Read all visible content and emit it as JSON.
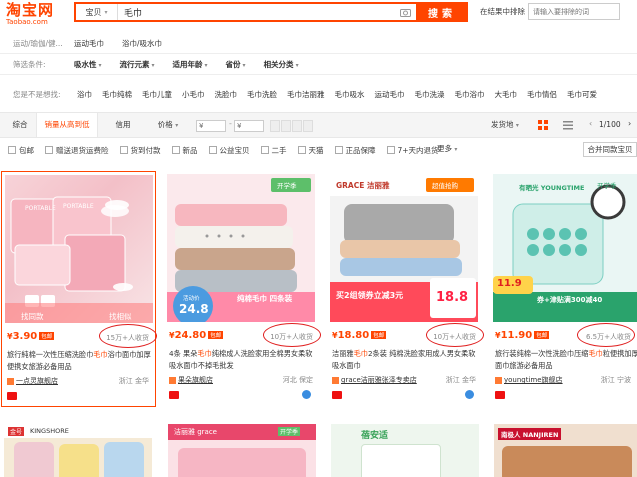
{
  "header": {
    "logo_main": "淘宝网",
    "logo_sub": "Taobao.com",
    "search_type": "宝贝",
    "search_value": "毛巾",
    "search_button": "搜索",
    "in_results_label": "在结果中排除",
    "in_results_placeholder": "请输入要排除的词"
  },
  "category_row": {
    "label": "运动/瑜伽/健...",
    "items": [
      "运动毛巾",
      "浴巾/吸水巾"
    ]
  },
  "filter_row": {
    "label": "筛选条件:",
    "items": [
      "吸水性",
      "流行元素",
      "适用年龄",
      "省份",
      "相关分类"
    ]
  },
  "related_row": {
    "label": "您是不是想找:",
    "items": [
      "浴巾",
      "毛巾纯棉",
      "毛巾儿童",
      "小毛巾",
      "洗脸巾",
      "毛巾洗脸",
      "毛巾洁丽雅",
      "毛巾吸水",
      "运动毛巾",
      "毛巾洗澡",
      "毛巾浴巾",
      "大毛巾",
      "毛巾情侣",
      "毛巾可爱"
    ]
  },
  "sort_bar": {
    "tabs": [
      "综合",
      "销量从高到低",
      "信用",
      "价格"
    ],
    "price_from": "¥",
    "price_to": "¥",
    "ship_from": "发货地",
    "page_indicator": "1/100"
  },
  "checkboxes": [
    "包邮",
    "赠送退货运费险",
    "货到付款",
    "新品",
    "公益宝贝",
    "二手",
    "天猫",
    "正品保障",
    "7+天内退货"
  ],
  "more_label": "更多",
  "merge_label": "合并同款宝贝",
  "products": [
    {
      "price": "3.90",
      "free_ship": "包邮",
      "sales": "15万+人收货",
      "title_pre": "旅行純棉一次性压缩洗脸巾",
      "title_hl": "毛巾",
      "title_post": "浴巾面巾加厚便携女旅游必备用品",
      "shop": "一点灵旗舰店",
      "location": "浙江 金华",
      "img_text_1": "PORTABLE",
      "img_btn_1": "找同款",
      "img_btn_2": "找相似"
    },
    {
      "price": "24.80",
      "free_ship": "包邮",
      "sales": "10万+人收货",
      "title_pre": "4条 果朵",
      "title_hl": "毛巾",
      "title_post": "纯棉成人洗脸家用全棉男女柔软吸水面巾不掉毛批发",
      "shop": "果朵旗舰店",
      "location": "河北 保定",
      "img_badge": "开学季",
      "img_promo": "纯棉毛巾 四条装",
      "img_price": "24.8",
      "img_note": "活动价"
    },
    {
      "price": "18.80",
      "free_ship": "包邮",
      "sales": "10万+人收货",
      "title_pre": "洁丽雅",
      "title_hl": "毛巾",
      "title_post": "2条装 纯棉洗脸家用成人男女柔软吸水面巾",
      "shop": "grace洁丽雅张泽专卖店",
      "location": "浙江 金华",
      "img_brand": "GRACE 洁丽雅",
      "img_badge": "超值抢购",
      "img_promo": "买2组领券立减3元",
      "img_price": "18.8"
    },
    {
      "price": "11.90",
      "free_ship": "包邮",
      "sales": "6.5万+人收货",
      "title_pre": "旅行装纯棉一次性洗脸巾压缩",
      "title_hl": "毛巾",
      "title_post": "粒便携加厚面巾旅游必备用品",
      "shop": "youngtime旗舰店",
      "location": "浙江 宁波",
      "img_brand": "有晒光 YOUNGTIME",
      "img_badge": "开学季",
      "img_price": "11.9",
      "img_promo": "券+津贴满300减40"
    }
  ],
  "row2": [
    {
      "label": "KINGSHORE"
    },
    {
      "label": "洁丽雅 grace",
      "badge": "开学季"
    },
    {
      "label": "蓓安适"
    },
    {
      "label": "南极人 NANJIREN"
    }
  ]
}
